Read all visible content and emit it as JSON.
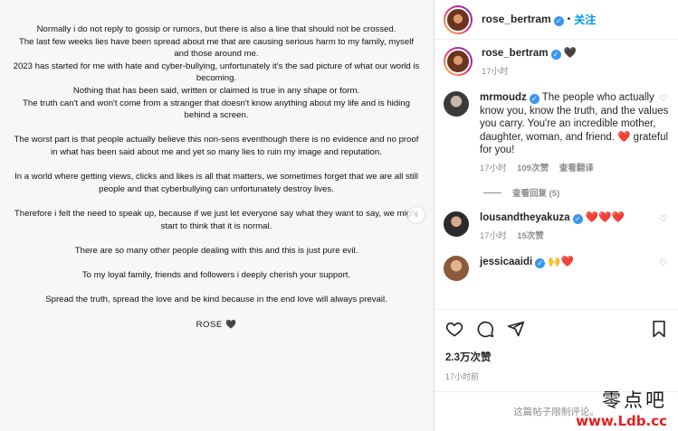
{
  "post": {
    "paragraphs": [
      "Normally i do not reply to gossip or rumors, but there is also a line that should not be crossed.\nThe last few weeks lies have been spread about me that are causing serious harm to my family, myself and those around me.\n2023 has started for me with hate and cyber-bullying, unfortunately it's the sad picture of what our world is becoming.\nNothing that has been said, written or claimed is true in any shape or form.\nThe truth can't and won't come from a stranger that doesn't know anything about my life and is hiding behind a screen.",
      "The worst part is that people actually believe this non-sens eventhough there is no evidence and no proof in what has been said about me and yet so many lies to ruin my image and reputation.",
      "In a world where getting views, clicks and likes is all that matters, we sometimes forget that we are all still people and that cyberbullying can unfortunately destroy lives.",
      "Therefore i felt the need to speak up, because if we just let everyone say what they want to say, we might start to think that it is normal.",
      "There are so many other people dealing with this and this is just pure evil.",
      "To my loyal family, friends and followers i deeply cherish your support.",
      "Spread the truth, spread the love and be kind because in the end love will always prevail."
    ],
    "signature": "ROSE 🖤"
  },
  "header": {
    "username": "rose_bertram",
    "verified_icon": "verified-badge",
    "separator": "•",
    "follow_label": "关注"
  },
  "caption": {
    "username": "rose_bertram",
    "emoji": "🖤",
    "time": "17小时"
  },
  "comments": [
    {
      "username": "mrmoudz",
      "text": "The people who actually know you, know the truth, and the values you carry. You're an incredible mother, daughter, woman, and friend. ❤️ grateful for you!",
      "time": "17小时",
      "likes": "109次赞",
      "translate": "查看翻译"
    },
    {
      "username": "lousandtheyakuza",
      "text": "❤️❤️❤️",
      "time": "17小时",
      "likes": "15次赞"
    },
    {
      "username": "jessicaaidi",
      "text": "🙌❤️"
    }
  ],
  "view_replies": "查看回复 (5)",
  "likes_count": "2.3万次赞",
  "post_time": "17小时前",
  "comments_limited": "这篇帖子限制评论。",
  "watermark": {
    "top": "零点吧",
    "bottom": "www.Ldb.cc"
  }
}
